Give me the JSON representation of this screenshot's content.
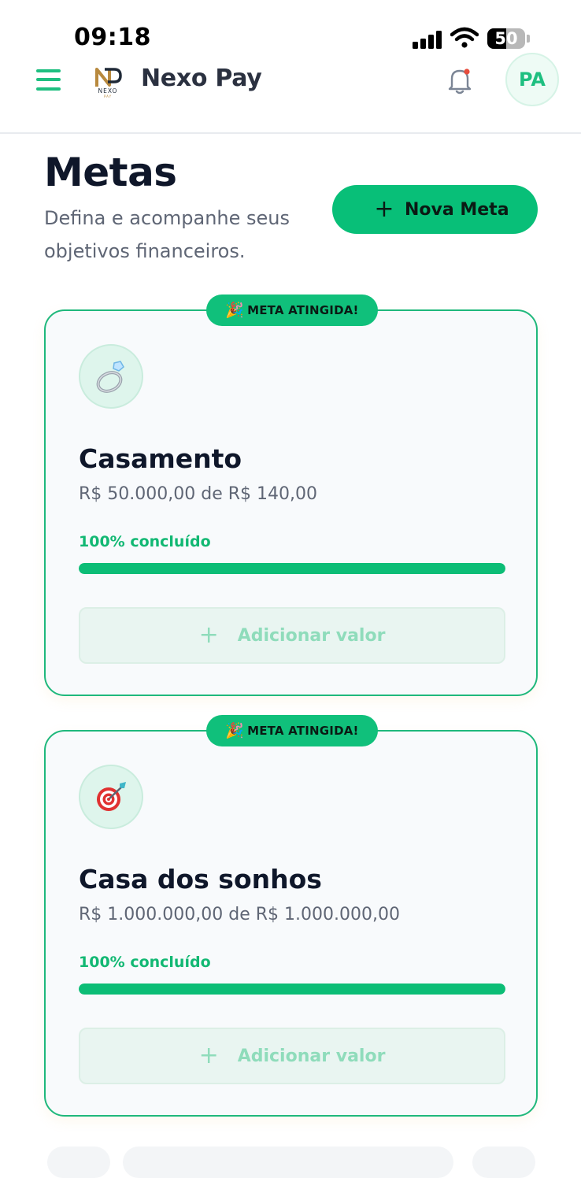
{
  "status_bar": {
    "time": "09:18",
    "battery": "50",
    "battery_level": 0.5
  },
  "header": {
    "brand": "Nexo Pay",
    "logo_text": "NEXO PAY",
    "avatar_initials": "PA",
    "icons": {
      "menu": "menu-icon",
      "bell": "bell-icon",
      "notification_dot": "#e74c3c"
    }
  },
  "page": {
    "title": "Metas",
    "subtitle": "Defina e acompanhe seus objetivos financeiros.",
    "new_goal_button": {
      "icon": "plus-icon",
      "label": "Nova Meta"
    }
  },
  "colors": {
    "accent": "#08bf78",
    "text": "#0f172a",
    "muted": "#5f6675"
  },
  "goals": [
    {
      "badge": "META ATINGIDA!",
      "badge_icon": "party-popper-icon",
      "icon": "ring-icon",
      "name": "Casamento",
      "amount_text": "R$ 50.000,00 de R$ 140,00",
      "progress_label": "100% concluído",
      "progress": 1.0,
      "add_button": {
        "icon": "plus-icon",
        "label": "Adicionar valor"
      }
    },
    {
      "badge": "META ATINGIDA!",
      "badge_icon": "party-popper-icon",
      "icon": "target-icon",
      "name": "Casa dos sonhos",
      "amount_text": "R$ 1.000.000,00 de R$ 1.000.000,00",
      "progress_label": "100% concluído",
      "progress": 1.0,
      "add_button": {
        "icon": "plus-icon",
        "label": "Adicionar valor"
      }
    }
  ]
}
